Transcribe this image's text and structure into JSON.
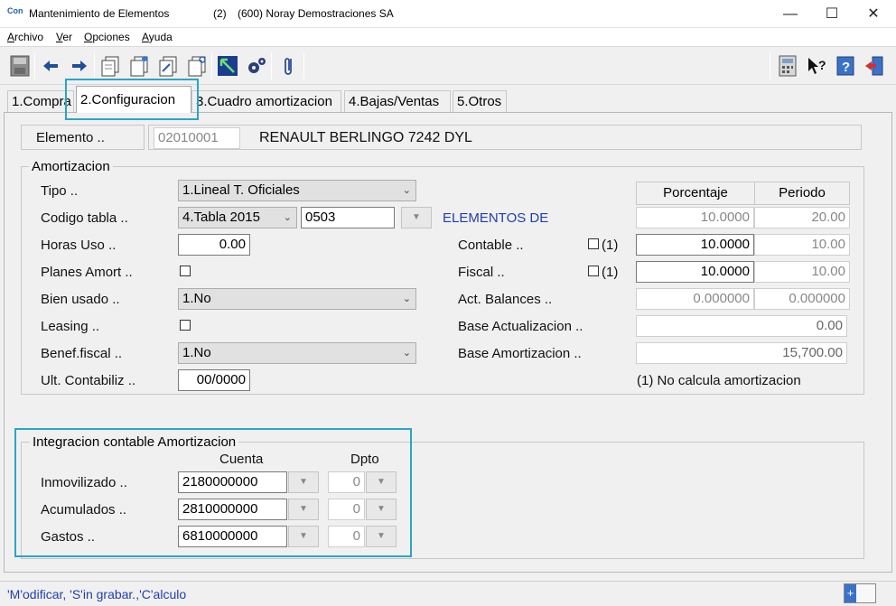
{
  "window": {
    "app_icon": "Con",
    "title": "Mantenimiento de Elementos",
    "counter": "(2)",
    "company": "(600) Noray Demostraciones SA",
    "minimize": "—",
    "maximize": "☐",
    "close": "✕"
  },
  "menu": [
    "Archivo",
    "Ver",
    "Opciones",
    "Ayuda"
  ],
  "tabs": [
    "1.Compra",
    "2.Configuracion",
    "3.Cuadro amortizacion",
    "4.Bajas/Ventas",
    "5.Otros"
  ],
  "element": {
    "label": "Elemento ..",
    "code": "02010001",
    "description": "RENAULT BERLINGO 7242 DYL"
  },
  "amortizacion": {
    "title": "Amortizacion",
    "tipo": {
      "label": "Tipo ..",
      "value": "1.Lineal T. Oficiales"
    },
    "codigo_tabla": {
      "label": "Codigo tabla ..",
      "value": "4.Tabla 2015",
      "code": "0503",
      "heading": "ELEMENTOS DE"
    },
    "horas_uso": {
      "label": "Horas Uso ..",
      "value": "0.00"
    },
    "planes_amort": {
      "label": "Planes Amort .."
    },
    "bien_usado": {
      "label": "Bien usado ..",
      "value": "1.No"
    },
    "leasing": {
      "label": "Leasing .."
    },
    "benef_fiscal": {
      "label": "Benef.fiscal ..",
      "value": "1.No"
    },
    "ult_contabiliz": {
      "label": "Ult. Contabiliz ..",
      "value": "00/0000"
    },
    "headers": {
      "porcentaje": "Porcentaje",
      "periodo": "Periodo"
    },
    "tabla": {
      "porcentaje": "10.0000",
      "periodo": "20.00"
    },
    "contable": {
      "label": "Contable ..",
      "flag": "(1)",
      "porcentaje": "10.0000",
      "periodo": "10.00"
    },
    "fiscal": {
      "label": "Fiscal ..",
      "flag": "(1)",
      "porcentaje": "10.0000",
      "periodo": "10.00"
    },
    "act_balances": {
      "label": "Act. Balances ..",
      "porcentaje": "0.000000",
      "periodo": "0.000000"
    },
    "base_actualizacion": {
      "label": "Base Actualizacion ..",
      "value": "0.00"
    },
    "base_amortizacion": {
      "label": "Base Amortizacion ..",
      "value": "15,700.00"
    },
    "note": "(1) No calcula amortizacion"
  },
  "integracion": {
    "title": "Integracion contable Amortizacion",
    "col_cuenta": "Cuenta",
    "col_dpto": "Dpto",
    "rows": [
      {
        "label": "Inmovilizado ..",
        "cuenta": "2180000000",
        "dpto": "0"
      },
      {
        "label": "Acumulados ..",
        "cuenta": "2810000000",
        "dpto": "0"
      },
      {
        "label": "Gastos ..",
        "cuenta": "6810000000",
        "dpto": "0"
      }
    ]
  },
  "status": {
    "text": "'M'odificar, 'S'in grabar.,'C'alculo",
    "button": "+"
  },
  "colors": {
    "highlight": "#29a6c7",
    "accent_blue": "#1f3fb0"
  },
  "icons": [
    "save-icon",
    "arrow-left-icon",
    "arrow-right-icon",
    "doc-copy-icon",
    "doc-new-icon",
    "doc-edit-icon",
    "doc-search-icon",
    "zoom-arrow-icon",
    "gears-icon",
    "paperclip-icon",
    "calculator-icon",
    "help-pointer-icon",
    "help-book-icon",
    "exit-door-icon"
  ]
}
